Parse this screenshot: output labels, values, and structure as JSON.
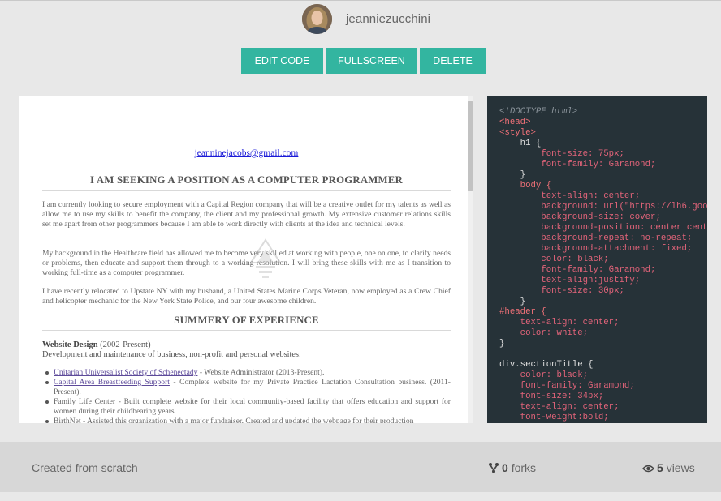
{
  "profile": {
    "username": "jeanniezucchini"
  },
  "actions": {
    "edit_label": "EDIT CODE",
    "fullscreen_label": "FULLSCREEN",
    "delete_label": "DELETE"
  },
  "preview": {
    "email": "jeanninejacobs@gmail.com",
    "heading": "I AM SEEKING A POSITION AS A COMPUTER PROGRAMMER",
    "paragraphs": [
      "I am currently looking to secure employment with a Capital Region company that will be a creative outlet for my talents as well as allow me to use my skills to benefit the company, the client and my professional growth. My extensive customer relations skills set me apart from other programmers because I am able to work directly with clients at the idea and technical levels.",
      "My background in the Healthcare field has allowed me to become very skilled at working with people, one on one, to clarify needs or problems, then educate and support them through to a working resolution. I will bring these skills with me as I transition to working full-time as a computer programmer.",
      "I have recently relocated to Upstate NY with my husband, a United States Marine Corps Veteran, now employed as a Crew Chief and helicopter mechanic for the New York State Police, and our four awesome children."
    ],
    "experience_heading": "SUMMERY OF EXPERIENCE",
    "experience_title": "Website Design",
    "experience_years": "(2002-Present)",
    "experience_desc": "Development and maintenance of business, non-profit and personal websites:",
    "items": [
      {
        "link": "Unitarian Universalist Society of Schenectady",
        "text": " - Website Administrator (2013-Present)."
      },
      {
        "link": "Capital Area Breastfeeding Support",
        "text": " - Complete website for my Private Practice Lactation Consultation business. (2011-Present)."
      },
      {
        "link": "",
        "text": "Family Life Center - Built complete website for their local community-based facility that offers education and support for women during their childbearing years."
      },
      {
        "link": "",
        "text": "BirthNet - Assisted this organization with a major fundraiser. Created and updated the webpage for their production"
      }
    ]
  },
  "code": {
    "lines": [
      "<!DOCTYPE html>",
      "<head>",
      "<style>",
      "    h1 {",
      "        font-size: 75px;",
      "        font-family: Garamond;",
      "    }",
      "    body {",
      "        text-align: center;",
      "        background: url(\"https://lh6.goog",
      "        background-size: cover;",
      "        background-position: center cente",
      "        background-repeat: no-repeat;",
      "        background-attachment: fixed;",
      "        color: black;",
      "        font-family: Garamond;",
      "        text-align:justify;",
      "        font-size: 30px;",
      "    }",
      "#header {",
      "    text-align: center;",
      "    color: white;",
      "}",
      "",
      "div.sectionTitle {",
      "    color: black;",
      "    font-family: Garamond;",
      "    font-size: 34px;",
      "    text-align: center;",
      "    font-weight:bold;"
    ]
  },
  "footer": {
    "created": "Created from scratch",
    "forks_count": "0",
    "forks_label": "forks",
    "views_count": "5",
    "views_label": "views"
  },
  "colors": {
    "accent": "#33b5a0",
    "code_bg": "#263238"
  }
}
